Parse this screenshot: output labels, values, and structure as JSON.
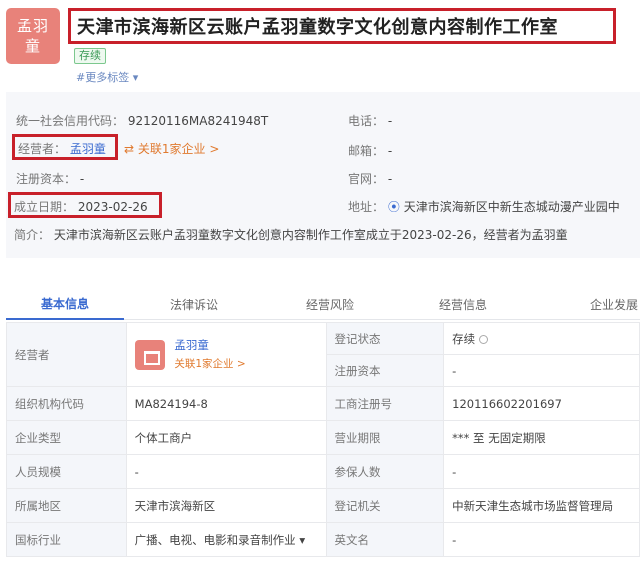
{
  "company": {
    "logo_text": "孟羽\n童",
    "name": "天津市滨海新区云账户孟羽童数字文化创意内容制作工作室",
    "status_tag": "存续",
    "more_tags": "#更多标签 ▾"
  },
  "info": {
    "credit_code_label": "统一社会信用代码：",
    "credit_code_value": "92120116MA8241948T",
    "phone_label": "电话：",
    "phone_value": "-",
    "operator_label": "经营者：",
    "operator_value": "孟羽童",
    "related_link": "关联1家企业 >",
    "email_label": "邮箱：",
    "email_value": "-",
    "capital_label": "注册资本：",
    "capital_value": "-",
    "website_label": "官网：",
    "website_value": "-",
    "established_label": "成立日期：",
    "established_value": "2023-02-26",
    "address_label": "地址：",
    "address_value": "天津市滨海新区中新生态城动漫产业园中",
    "intro_label": "简介：",
    "intro_value": "天津市滨海新区云账户孟羽童数字文化创意内容制作工作室成立于2023-02-26，经营者为孟羽童"
  },
  "tabs": [
    "基本信息",
    "法律诉讼",
    "经营风险",
    "经营信息",
    "企业发展"
  ],
  "table": {
    "operator_label": "经营者",
    "operator_name": "孟羽童",
    "operator_related": "关联1家企业 >",
    "reg_status_label": "登记状态",
    "reg_status_value": "存续",
    "reg_capital_label": "注册资本",
    "reg_capital_value": "-",
    "org_code_label": "组织机构代码",
    "org_code_value": "MA824194-8",
    "biz_reg_label": "工商注册号",
    "biz_reg_value": "120116602201697",
    "type_label": "企业类型",
    "type_value": "个体工商户",
    "term_label": "营业期限",
    "term_value": "*** 至 无固定期限",
    "staff_label": "人员规模",
    "staff_value": "-",
    "insured_label": "参保人数",
    "insured_value": "-",
    "region_label": "所属地区",
    "region_value": "天津市滨海新区",
    "authority_label": "登记机关",
    "authority_value": "中新天津生态城市场监督管理局",
    "industry_label": "国标行业",
    "industry_value": "广播、电视、电影和录音制作业 ▾",
    "english_label": "英文名",
    "english_value": "-"
  }
}
